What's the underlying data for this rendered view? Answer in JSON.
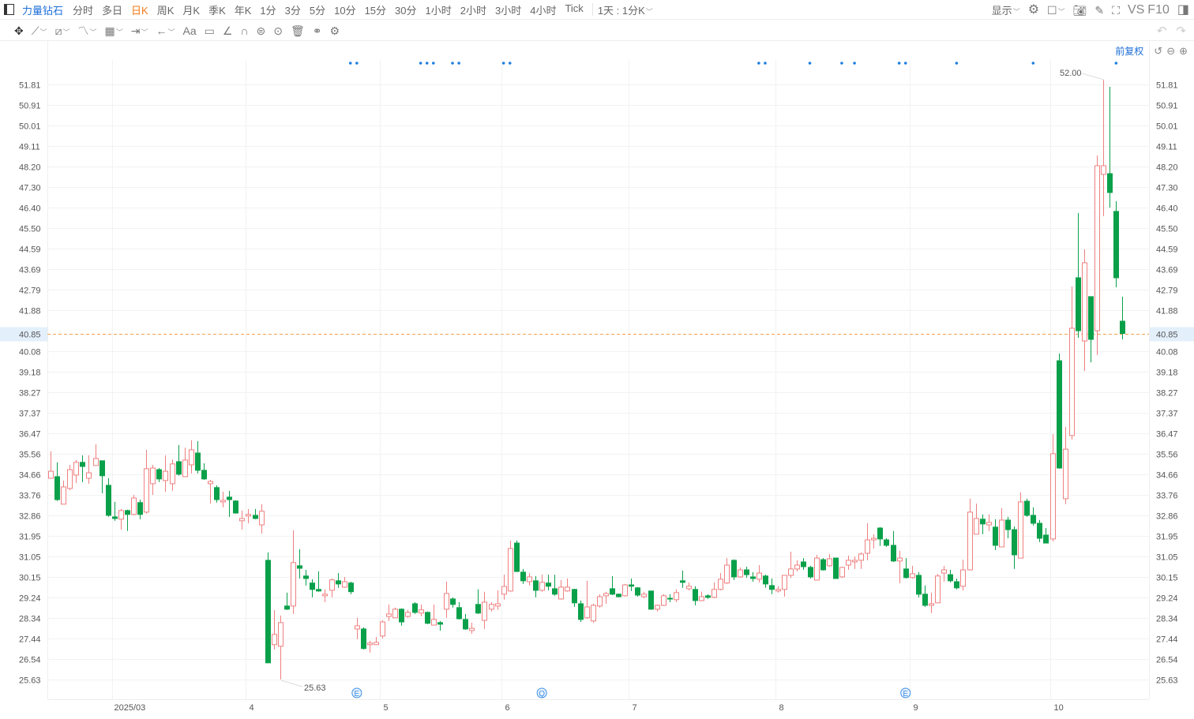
{
  "toolbar": {
    "symbol": "力量钻石",
    "periods": [
      "分时",
      "多日",
      "日K",
      "周K",
      "月K",
      "季K",
      "年K",
      "1分",
      "3分",
      "5分",
      "10分",
      "15分",
      "30分",
      "1小时",
      "2小时",
      "3小时",
      "4小时",
      "Tick"
    ],
    "active_period": "日K",
    "interval_select": "1天 : 1分K",
    "display_label": "显示",
    "vs_label": "VS",
    "f10_label": "F10",
    "text_tool": "Aa"
  },
  "chart_header": {
    "adjust_label": "前复权"
  },
  "chart_data": {
    "type": "candlestick",
    "y_ticks": [
      "51.81",
      "50.91",
      "50.01",
      "49.11",
      "48.20",
      "47.30",
      "46.40",
      "45.50",
      "44.59",
      "43.69",
      "42.79",
      "41.88",
      "40.08",
      "39.18",
      "38.27",
      "37.37",
      "36.47",
      "35.56",
      "34.66",
      "33.76",
      "32.86",
      "31.95",
      "31.05",
      "30.15",
      "29.24",
      "28.34",
      "27.44",
      "26.54",
      "25.63"
    ],
    "ylim": [
      25.63,
      51.81
    ],
    "last_price": "40.85",
    "high_label": "52.00",
    "low_label": "25.63",
    "x_labels": [
      {
        "text": "2025/03",
        "candle": 10
      },
      {
        "text": "4",
        "candle": 31
      },
      {
        "text": "5",
        "candle": 52
      },
      {
        "text": "6",
        "candle": 71
      },
      {
        "text": "7",
        "candle": 91
      },
      {
        "text": "8",
        "candle": 114
      },
      {
        "text": "9",
        "candle": 135
      },
      {
        "text": "10",
        "candle": 157
      }
    ],
    "event_markers": [
      47,
      48,
      58,
      59,
      60,
      63,
      64,
      71,
      72,
      111,
      112,
      119,
      124,
      126,
      133,
      134,
      142,
      154,
      167
    ],
    "bottom_badges": [
      {
        "text": "E",
        "candle": 48
      },
      {
        "text": "Q",
        "candle": 77
      },
      {
        "text": "E",
        "candle": 134
      }
    ],
    "colors": {
      "up": "#ef8080",
      "down": "#0aa04a",
      "last_price": "#f0a050",
      "marker": "#1e7fe0"
    },
    "ohlc": [
      [
        34.48,
        34.79,
        35.66,
        34.48
      ],
      [
        34.55,
        33.54,
        35.18,
        33.48
      ],
      [
        33.34,
        34.1,
        34.38,
        33.34
      ],
      [
        34.03,
        34.86,
        35.07,
        33.96
      ],
      [
        34.62,
        35.18,
        35.28,
        34.27
      ],
      [
        35.18,
        35.0,
        35.49,
        34.31
      ],
      [
        34.48,
        34.72,
        35.49,
        34.24
      ],
      [
        35.04,
        35.35,
        35.97,
        35.04
      ],
      [
        35.25,
        34.59,
        35.25,
        33.82
      ],
      [
        34.17,
        32.85,
        34.48,
        32.78
      ],
      [
        32.78,
        32.71,
        33.44,
        32.61
      ],
      [
        32.68,
        33.06,
        33.13,
        32.22
      ],
      [
        33.06,
        32.89,
        33.1,
        32.16
      ],
      [
        32.89,
        33.61,
        33.75,
        32.85
      ],
      [
        33.41,
        32.89,
        33.54,
        32.68
      ],
      [
        32.99,
        34.9,
        35.73,
        32.92
      ],
      [
        34.24,
        34.93,
        35.07,
        33.75
      ],
      [
        34.86,
        34.45,
        34.93,
        34.31
      ],
      [
        34.38,
        34.79,
        35.49,
        33.89
      ],
      [
        34.24,
        35.11,
        35.31,
        33.93
      ],
      [
        35.21,
        34.66,
        35.94,
        34.59
      ],
      [
        34.55,
        35.28,
        35.83,
        34.55
      ],
      [
        35.07,
        35.73,
        36.15,
        34.69
      ],
      [
        35.59,
        34.83,
        36.11,
        34.69
      ],
      [
        34.83,
        34.45,
        35.14,
        34.41
      ],
      [
        34.24,
        34.34,
        34.41,
        33.37
      ],
      [
        34.07,
        33.54,
        34.17,
        33.41
      ],
      [
        33.44,
        33.51,
        33.89,
        33.2
      ],
      [
        33.65,
        33.54,
        33.93,
        32.78
      ],
      [
        33.48,
        32.95,
        33.51,
        32.92
      ],
      [
        32.61,
        32.71,
        33.06,
        32.22
      ],
      [
        32.82,
        32.89,
        33.13,
        32.5
      ],
      [
        32.85,
        32.71,
        33.13,
        32.68
      ],
      [
        32.43,
        33.03,
        33.34,
        32.05
      ],
      [
        30.87,
        26.36,
        31.22,
        26.36
      ],
      [
        27.16,
        27.61,
        28.68,
        26.95
      ],
      [
        27.09,
        28.13,
        28.44,
        25.63
      ],
      [
        28.86,
        28.72,
        29.45,
        28.69
      ],
      [
        28.86,
        30.77,
        32.19,
        28.51
      ],
      [
        30.63,
        30.52,
        31.36,
        30.07
      ],
      [
        30.18,
        30.07,
        30.45,
        29.76
      ],
      [
        29.87,
        29.59,
        30.04,
        29.24
      ],
      [
        29.59,
        29.52,
        30.38,
        29.49
      ],
      [
        29.31,
        29.38,
        29.59,
        29.03
      ],
      [
        29.55,
        30.01,
        30.07,
        29.24
      ],
      [
        29.97,
        29.83,
        30.31,
        29.66
      ],
      [
        29.69,
        29.93,
        30.14,
        29.66
      ],
      [
        29.87,
        29.49,
        29.93,
        29.38
      ],
      [
        27.85,
        27.99,
        28.34,
        27.4
      ],
      [
        27.85,
        26.99,
        27.92,
        26.95
      ],
      [
        27.16,
        27.23,
        27.33,
        26.81
      ],
      [
        27.16,
        27.26,
        27.5,
        27.16
      ],
      [
        27.54,
        28.16,
        28.23,
        27.43
      ],
      [
        28.4,
        28.51,
        28.93,
        28.2
      ],
      [
        28.34,
        28.72,
        28.79,
        28.34
      ],
      [
        28.72,
        28.16,
        28.76,
        27.99
      ],
      [
        28.4,
        28.58,
        28.69,
        28.34
      ],
      [
        28.96,
        28.58,
        29.03,
        28.51
      ],
      [
        28.55,
        28.69,
        28.93,
        28.41
      ],
      [
        28.58,
        28.1,
        28.62,
        28.06
      ],
      [
        28.02,
        28.27,
        28.93,
        28.02
      ],
      [
        28.13,
        28.06,
        28.2,
        27.78
      ],
      [
        28.72,
        29.41,
        29.93,
        28.34
      ],
      [
        29.17,
        28.93,
        29.24,
        28.79
      ],
      [
        28.79,
        28.3,
        29.03,
        28.27
      ],
      [
        28.27,
        27.85,
        28.51,
        27.81
      ],
      [
        27.78,
        27.88,
        28.13,
        27.64
      ],
      [
        28.93,
        28.55,
        29.59,
        28.51
      ],
      [
        28.23,
        29.03,
        29.49,
        27.85
      ],
      [
        28.72,
        28.93,
        29.03,
        28.62
      ],
      [
        28.86,
        28.96,
        29.55,
        28.69
      ],
      [
        29.38,
        29.72,
        30.24,
        29.14
      ],
      [
        29.52,
        31.39,
        31.74,
        29.49
      ],
      [
        31.63,
        30.38,
        31.74,
        30.35
      ],
      [
        30.35,
        29.97,
        30.49,
        29.83
      ],
      [
        29.93,
        30.14,
        30.31,
        29.76
      ],
      [
        29.97,
        29.55,
        30.18,
        29.24
      ],
      [
        29.55,
        29.9,
        30.24,
        29.49
      ],
      [
        29.87,
        29.73,
        30.24,
        29.55
      ],
      [
        29.62,
        29.38,
        30.24,
        29.31
      ],
      [
        29.17,
        29.69,
        30.0,
        29.14
      ],
      [
        29.52,
        29.69,
        30.07,
        29.49
      ],
      [
        29.59,
        29.0,
        29.62,
        28.82
      ],
      [
        28.96,
        28.27,
        29.1,
        28.16
      ],
      [
        28.34,
        28.82,
        29.97,
        28.3
      ],
      [
        28.2,
        28.89,
        28.96,
        28.13
      ],
      [
        28.86,
        29.27,
        29.38,
        28.79
      ],
      [
        29.31,
        29.41,
        29.49,
        28.96
      ],
      [
        29.62,
        29.38,
        30.18,
        29.34
      ],
      [
        29.38,
        29.27,
        29.41,
        29.24
      ],
      [
        29.31,
        29.79,
        29.83,
        29.27
      ],
      [
        29.79,
        29.73,
        30.07,
        29.52
      ],
      [
        29.66,
        29.34,
        29.69,
        29.27
      ],
      [
        29.27,
        29.38,
        29.49,
        29.2
      ],
      [
        29.52,
        28.72,
        29.52,
        28.69
      ],
      [
        28.72,
        28.89,
        28.93,
        28.62
      ],
      [
        28.89,
        29.31,
        29.38,
        28.86
      ],
      [
        29.2,
        29.17,
        29.38,
        29.03
      ],
      [
        29.14,
        29.45,
        29.59,
        29.03
      ],
      [
        29.97,
        29.9,
        30.42,
        29.66
      ],
      [
        29.62,
        29.73,
        29.9,
        29.55
      ],
      [
        29.59,
        29.1,
        29.73,
        28.89
      ],
      [
        29.1,
        29.27,
        29.49,
        29.07
      ],
      [
        29.31,
        29.24,
        29.38,
        29.17
      ],
      [
        29.24,
        29.59,
        29.9,
        29.2
      ],
      [
        29.59,
        30.04,
        30.31,
        29.55
      ],
      [
        29.87,
        30.66,
        30.97,
        29.83
      ],
      [
        30.87,
        30.14,
        30.91,
        30.0
      ],
      [
        30.14,
        30.45,
        30.56,
        30.1
      ],
      [
        30.45,
        30.24,
        30.59,
        30.1
      ],
      [
        30.14,
        30.07,
        30.35,
        29.93
      ],
      [
        30.04,
        30.31,
        30.66,
        29.9
      ],
      [
        30.18,
        29.83,
        30.24,
        29.66
      ],
      [
        29.76,
        29.59,
        30.07,
        29.38
      ],
      [
        29.52,
        29.59,
        29.73,
        29.45
      ],
      [
        29.59,
        30.21,
        30.21,
        29.27
      ],
      [
        30.21,
        30.49,
        31.25,
        30.1
      ],
      [
        30.49,
        30.66,
        30.87,
        30.38
      ],
      [
        30.8,
        30.59,
        30.97,
        30.45
      ],
      [
        30.56,
        30.14,
        30.63,
        30.07
      ],
      [
        30.0,
        30.97,
        31.11,
        30.0
      ],
      [
        30.9,
        30.45,
        30.97,
        30.42
      ],
      [
        30.63,
        30.94,
        31.15,
        30.59
      ],
      [
        30.97,
        30.07,
        30.97,
        30.07
      ],
      [
        30.14,
        30.56,
        30.59,
        30.1
      ],
      [
        30.66,
        30.87,
        31.08,
        30.45
      ],
      [
        30.8,
        30.87,
        31.04,
        30.49
      ],
      [
        30.87,
        31.15,
        31.22,
        30.49
      ],
      [
        31.18,
        31.77,
        32.5,
        30.87
      ],
      [
        31.77,
        31.84,
        32.02,
        31.39
      ],
      [
        32.29,
        31.81,
        32.33,
        31.5
      ],
      [
        31.77,
        31.53,
        31.84,
        31.46
      ],
      [
        31.53,
        30.84,
        32.16,
        30.8
      ],
      [
        30.84,
        30.97,
        31.29,
        29.86
      ],
      [
        30.49,
        30.11,
        30.97,
        30.07
      ],
      [
        30.11,
        30.28,
        30.63,
        30.07
      ],
      [
        30.21,
        29.38,
        30.35,
        29.24
      ],
      [
        29.38,
        28.89,
        29.76,
        28.82
      ],
      [
        28.89,
        28.96,
        29.45,
        28.55
      ],
      [
        29.0,
        30.18,
        30.28,
        29.0
      ],
      [
        30.31,
        30.45,
        30.63,
        29.93
      ],
      [
        30.24,
        29.97,
        30.45,
        29.9
      ],
      [
        29.93,
        29.66,
        30.07,
        29.59
      ],
      [
        29.73,
        30.45,
        30.9,
        29.55
      ],
      [
        30.45,
        32.99,
        33.58,
        30.45
      ],
      [
        32.02,
        32.71,
        33.37,
        32.02
      ],
      [
        32.68,
        32.47,
        32.89,
        32.02
      ],
      [
        32.43,
        32.54,
        32.89,
        32.16
      ],
      [
        32.33,
        31.53,
        32.68,
        31.32
      ],
      [
        31.46,
        32.64,
        33.16,
        31.46
      ],
      [
        32.64,
        32.22,
        32.78,
        31.84
      ],
      [
        32.22,
        31.11,
        32.36,
        30.49
      ],
      [
        30.97,
        33.44,
        33.86,
        30.97
      ],
      [
        33.47,
        32.85,
        33.58,
        32.78
      ],
      [
        32.85,
        32.5,
        33.2,
        32.4
      ],
      [
        32.5,
        31.84,
        32.64,
        31.67
      ],
      [
        31.98,
        31.63,
        32.29,
        31.63
      ],
      [
        31.81,
        35.56,
        36.42,
        31.7
      ],
      [
        39.65,
        34.93,
        39.97,
        34.9
      ],
      [
        33.58,
        35.76,
        36.74,
        33.34
      ],
      [
        36.36,
        41.08,
        42.92,
        36.18
      ],
      [
        43.3,
        40.97,
        46.15,
        40.66
      ],
      [
        40.52,
        43.96,
        44.55,
        39.2
      ],
      [
        42.47,
        40.59,
        42.47,
        39.58
      ],
      [
        40.97,
        48.23,
        48.68,
        39.9
      ],
      [
        47.85,
        48.23,
        52.0,
        46.01
      ],
      [
        47.88,
        47.05,
        51.7,
        46.39
      ],
      [
        46.22,
        43.3,
        46.67,
        42.88
      ],
      [
        41.39,
        40.85,
        42.47,
        40.59
      ]
    ]
  }
}
